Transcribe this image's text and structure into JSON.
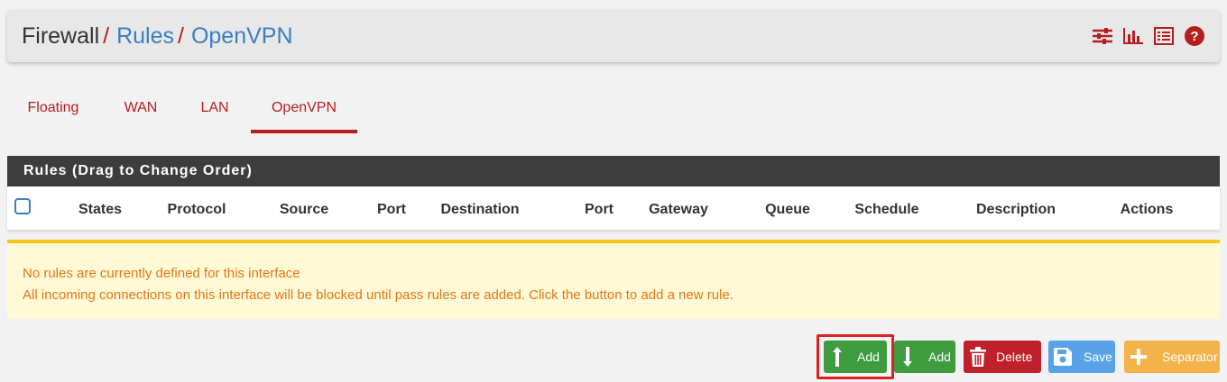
{
  "breadcrumb": {
    "root": "Firewall",
    "separator": "/",
    "rules": "Rules",
    "interface": "OpenVPN"
  },
  "header_icons": [
    "sliders-icon",
    "bar-chart-icon",
    "list-icon",
    "help-icon"
  ],
  "tabs": [
    {
      "label": "Floating",
      "active": false
    },
    {
      "label": "WAN",
      "active": false
    },
    {
      "label": "LAN",
      "active": false
    },
    {
      "label": "OpenVPN",
      "active": true
    }
  ],
  "rules_panel": {
    "title": "Rules (Drag to Change Order)",
    "columns": [
      "States",
      "Protocol",
      "Source",
      "Port",
      "Destination",
      "Port",
      "Gateway",
      "Queue",
      "Schedule",
      "Description",
      "Actions"
    ]
  },
  "alert": {
    "line1": "No rules are currently defined for this interface",
    "line2": "All incoming connections on this interface will be blocked until pass rules are added. Click the button to add a new rule."
  },
  "buttons": {
    "add_top": "Add",
    "add_bottom": "Add",
    "delete": "Delete",
    "save": "Save",
    "separator": "Separator"
  },
  "colors": {
    "accent_red": "#b41e1e",
    "link_blue": "#3a7fc1",
    "success_green": "#3e9b3e",
    "warning_yellow": "#f5c518"
  }
}
